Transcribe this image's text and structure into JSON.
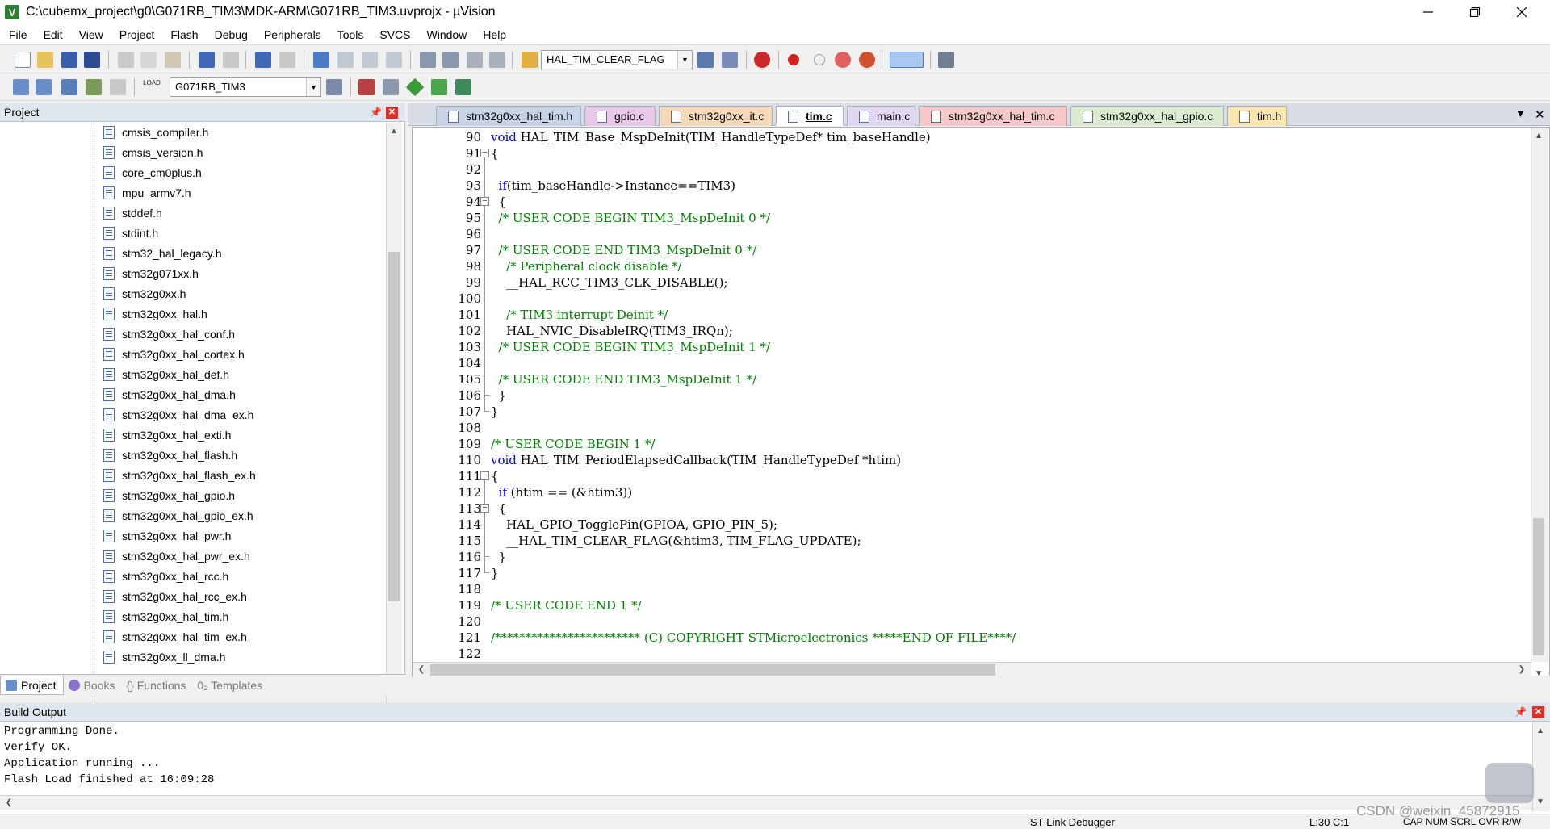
{
  "window": {
    "title": "C:\\cubemx_project\\g0\\G071RB_TIM3\\MDK-ARM\\G071RB_TIM3.uvprojx - µVision",
    "app_icon_letter": "V"
  },
  "menu": [
    "File",
    "Edit",
    "View",
    "Project",
    "Flash",
    "Debug",
    "Peripherals",
    "Tools",
    "SVCS",
    "Window",
    "Help"
  ],
  "toolbar": {
    "find_combo_value": "HAL_TIM_CLEAR_FLAG",
    "target_combo_value": "G071RB_TIM3",
    "load_label": "LOAD"
  },
  "project_panel": {
    "title": "Project",
    "files": [
      "cmsis_compiler.h",
      "cmsis_version.h",
      "core_cm0plus.h",
      "mpu_armv7.h",
      "stddef.h",
      "stdint.h",
      "stm32_hal_legacy.h",
      "stm32g071xx.h",
      "stm32g0xx.h",
      "stm32g0xx_hal.h",
      "stm32g0xx_hal_conf.h",
      "stm32g0xx_hal_cortex.h",
      "stm32g0xx_hal_def.h",
      "stm32g0xx_hal_dma.h",
      "stm32g0xx_hal_dma_ex.h",
      "stm32g0xx_hal_exti.h",
      "stm32g0xx_hal_flash.h",
      "stm32g0xx_hal_flash_ex.h",
      "stm32g0xx_hal_gpio.h",
      "stm32g0xx_hal_gpio_ex.h",
      "stm32g0xx_hal_pwr.h",
      "stm32g0xx_hal_pwr_ex.h",
      "stm32g0xx_hal_rcc.h",
      "stm32g0xx_hal_rcc_ex.h",
      "stm32g0xx_hal_tim.h",
      "stm32g0xx_hal_tim_ex.h",
      "stm32g0xx_ll_dma.h"
    ],
    "tabs": [
      "Project",
      "Books",
      "{} Functions",
      "0₂ Templates"
    ]
  },
  "editor_tabs": [
    {
      "label": "stm32g0xx_hal_tim.h",
      "color": "#c9d3e6"
    },
    {
      "label": "gpio.c",
      "color": "#e8c8e8"
    },
    {
      "label": "stm32g0xx_it.c",
      "color": "#f6d9b8"
    },
    {
      "label": "tim.c",
      "color": "#ffffff",
      "active": true
    },
    {
      "label": "main.c",
      "color": "#e3d6f0"
    },
    {
      "label": "stm32g0xx_hal_tim.c",
      "color": "#f6c8c8"
    },
    {
      "label": "stm32g0xx_hal_gpio.c",
      "color": "#dcebd0"
    },
    {
      "label": "tim.h",
      "color": "#fbe6b0"
    }
  ],
  "code": {
    "first_line": 90,
    "lines": [
      "void HAL_TIM_Base_MspDeInit(TIM_HandleTypeDef* tim_baseHandle)",
      "{",
      "",
      "  if(tim_baseHandle->Instance==TIM3)",
      "  {",
      "  /* USER CODE BEGIN TIM3_MspDeInit 0 */",
      "",
      "  /* USER CODE END TIM3_MspDeInit 0 */",
      "    /* Peripheral clock disable */",
      "    __HAL_RCC_TIM3_CLK_DISABLE();",
      "",
      "    /* TIM3 interrupt Deinit */",
      "    HAL_NVIC_DisableIRQ(TIM3_IRQn);",
      "  /* USER CODE BEGIN TIM3_MspDeInit 1 */",
      "",
      "  /* USER CODE END TIM3_MspDeInit 1 */",
      "  }",
      "}",
      "",
      "/* USER CODE BEGIN 1 */",
      "void HAL_TIM_PeriodElapsedCallback(TIM_HandleTypeDef *htim)",
      "{",
      "  if (htim == (&htim3))",
      "  {",
      "    HAL_GPIO_TogglePin(GPIOA, GPIO_PIN_5);",
      "    __HAL_TIM_CLEAR_FLAG(&htim3, TIM_FLAG_UPDATE);",
      "  }",
      "}",
      "",
      "/* USER CODE END 1 */",
      "",
      "/************************ (C) COPYRIGHT STMicroelectronics *****END OF FILE****/",
      ""
    ]
  },
  "build_output": {
    "title": "Build Output",
    "lines": [
      "Programming Done.",
      "Verify OK.",
      "Application running ...",
      "Flash Load finished at 16:09:28"
    ]
  },
  "status": {
    "debugger": "ST-Link Debugger",
    "position": "L:30 C:1",
    "flags": "CAP  NUM  SCRL  OVR  R/W"
  },
  "watermark": "CSDN @weixin_45872915"
}
